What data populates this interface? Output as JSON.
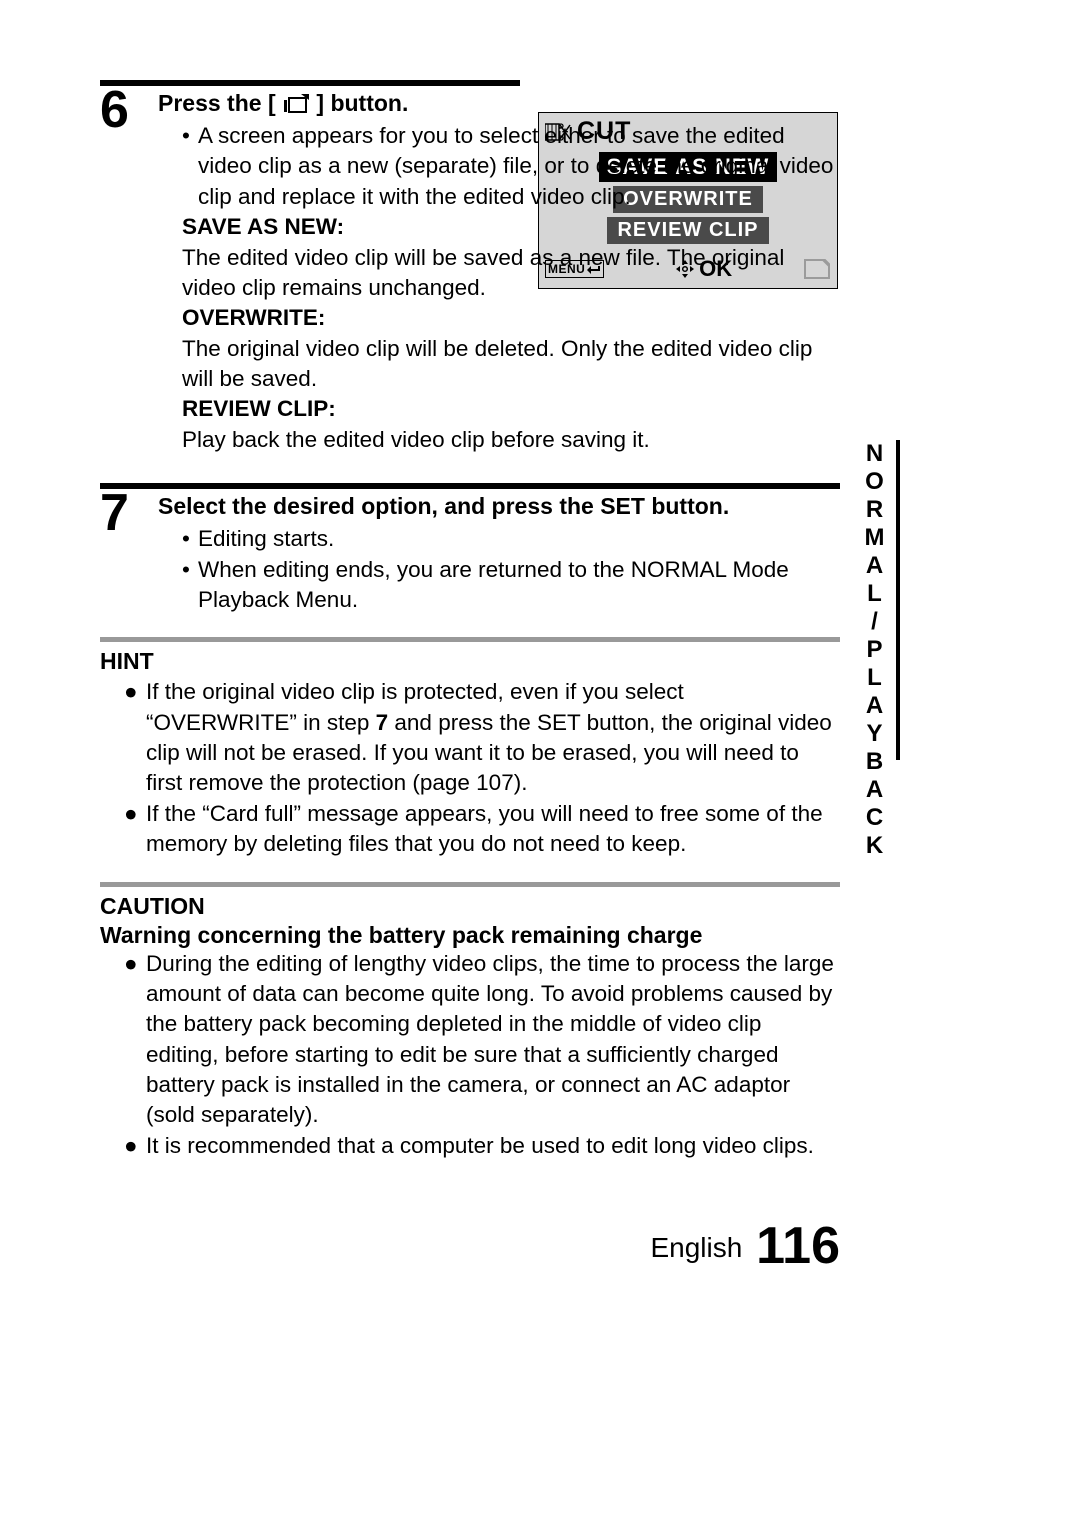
{
  "side_tab": "NORMAL/PLAYBACK",
  "step6": {
    "number": "6",
    "title_pre": "Press the [ ",
    "title_post": " ] button.",
    "intro": "A screen appears for you to select either to save the edited video clip as a new (separate) file, or to delete the original video clip and replace it with the edited video clip.",
    "save_label": "SAVE AS NEW:",
    "save_desc": "The edited video clip will be saved as a new file. The original video clip remains unchanged.",
    "over_label": "OVERWRITE:",
    "over_desc": "The original video clip will be deleted. Only the edited video clip will be saved.",
    "review_label": "REVIEW CLIP:",
    "review_desc": "Play back the edited video clip before saving it."
  },
  "cut_screen": {
    "title": "CUT",
    "opt1": "SAVE AS NEW",
    "opt2": "OVERWRITE",
    "opt3": "REVIEW CLIP",
    "menu": "MENU",
    "ok": "OK"
  },
  "step7": {
    "number": "7",
    "title": "Select the desired option, and press the SET button.",
    "b1": "Editing starts.",
    "b2": "When editing ends, you are returned to the NORMAL Mode Playback Menu."
  },
  "hint": {
    "heading": "HINT",
    "b1_pre": "If the original video clip is protected, even if you select “OVERWRITE” in step ",
    "b1_bold": "7",
    "b1_post": " and press the SET button, the original video clip will not be erased. If you want it to be erased, you will need to first remove the protection (page 107).",
    "b2": "If the “Card full” message appears, you will need to free some of the memory by deleting files that you do not need to keep."
  },
  "caution": {
    "heading": "CAUTION",
    "subheading": "Warning concerning the battery pack remaining charge",
    "b1": "During the editing of lengthy video clips, the time to process the large amount of data can become quite long. To avoid problems caused by the battery pack becoming depleted in the middle of video clip editing, before starting to edit be sure that a sufficiently charged battery pack is installed in the camera, or connect an AC adaptor (sold separately).",
    "b2": "It is recommended that a computer be used to edit long video clips."
  },
  "footer": {
    "lang": "English",
    "page": "116"
  }
}
